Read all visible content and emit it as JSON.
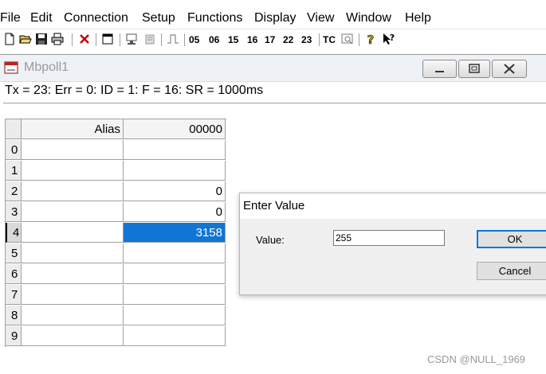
{
  "menu": [
    "File",
    "Edit",
    "Connection",
    "Setup",
    "Functions",
    "Display",
    "View",
    "Window",
    "Help"
  ],
  "toolbar": {
    "function_codes": [
      "05",
      "06",
      "15",
      "16",
      "17",
      "22",
      "23"
    ],
    "tc_label": "TC"
  },
  "child_window": {
    "title": "Mbpoll1",
    "status": "Tx = 23: Err = 0: ID = 1: F = 16: SR = 1000ms",
    "grid": {
      "alias_header": "Alias",
      "value_header": "00000",
      "rows": [
        {
          "index": "0",
          "alias": "",
          "value": ""
        },
        {
          "index": "1",
          "alias": "",
          "value": ""
        },
        {
          "index": "2",
          "alias": "",
          "value": "0"
        },
        {
          "index": "3",
          "alias": "",
          "value": "0"
        },
        {
          "index": "4",
          "alias": "",
          "value": "3158"
        },
        {
          "index": "5",
          "alias": "",
          "value": ""
        },
        {
          "index": "6",
          "alias": "",
          "value": ""
        },
        {
          "index": "7",
          "alias": "",
          "value": ""
        },
        {
          "index": "8",
          "alias": "",
          "value": ""
        },
        {
          "index": "9",
          "alias": "",
          "value": ""
        }
      ]
    }
  },
  "dialog": {
    "title": "Enter Value",
    "value_label": "Value:",
    "value": "255",
    "ok_label": "OK",
    "cancel_label": "Cancel"
  },
  "watermark": "CSDN @NULL_1969"
}
